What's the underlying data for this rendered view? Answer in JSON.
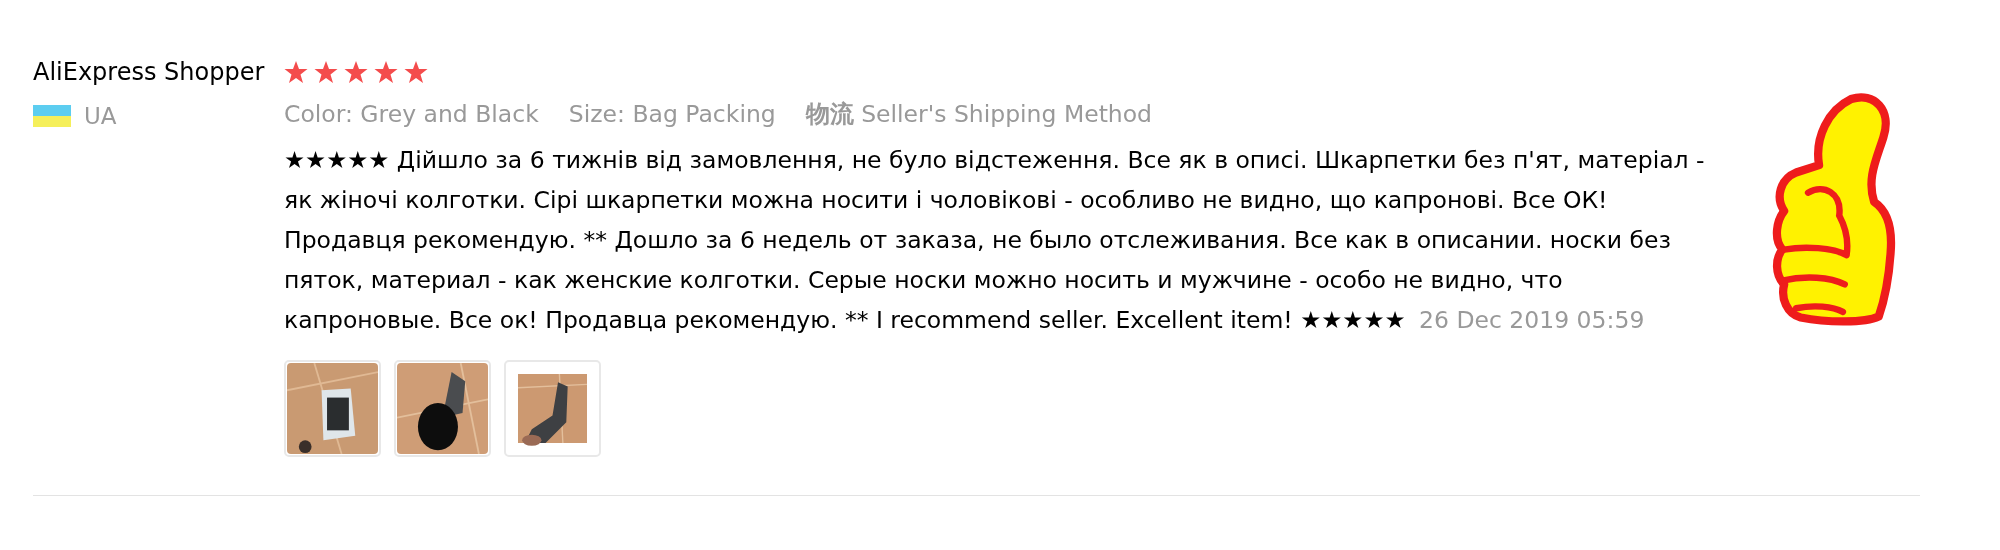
{
  "reviewer": {
    "name": "AliExpress Shopper",
    "stars": 5,
    "country": "UA"
  },
  "attributes": [
    "Color: Grey and Black",
    "Size: Bag Packing",
    "**物流** Seller's Shipping Method"
  ],
  "review": {
    "text": "★★★★★ Дійшло за 6 тижнів від замовлення, не було відстеження. Все як в описі. Шкарпетки без п'ят, матеріал - як жіночі колготки. Сірі шкарпетки можна носити і чоловікові - особливо не видно, що капронові. Все ОК! Продавця рекомендую. ** Дошло за 6 недель от заказа, не было отслеживания. Все как в описании. носки без пяток, материал - как женские колготки. Серые носки можно носить и мужчине - особо не видно, что капроновые. Все ок! Продавца рекомендую. ** I recommend seller. Excellent item! ★★★★★",
    "date": "26 Dec 2019 05:59"
  }
}
